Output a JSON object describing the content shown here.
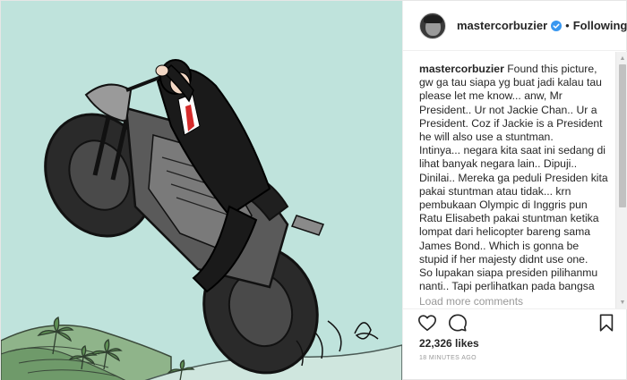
{
  "post": {
    "username": "mastercorbuzier",
    "separator": "•",
    "follow_status": "Following",
    "caption_author": "mastercorbuzier",
    "caption_text": "Found this picture, gw ga tau siapa yg buat jadi kalau tau please let me know... anw, Mr President.. Ur not Jackie Chan.. Ur a President. Coz if Jackie is a President he will also use a stuntman.\nIntinya... negara kita saat ini sedang di lihat banyak negara lain.. Dipuji.. Dinilai.. Mereka ga peduli Presiden kita pakai stuntman atau tidak... krn pembukaan Olympic di Inggris pun Ratu Elisabeth pakai stuntman ketika lompat dari helicopter bareng sama James Bond.. Which is gonna be stupid if her majesty didnt use one.\nSo lupakan siapa presiden pilihanmu nanti.. Tapi perlihatkan pada bangsa lain yang kebetulan ada di negara kita... that we are coll as it is...\nPS; I gonna need BIGGER bike if I'm the President...",
    "load_more": "Load more comments",
    "likes": "22,326 likes",
    "timestamp": "18 MINUTES AGO"
  },
  "icons": {
    "verified": "verified-badge-icon",
    "like": "heart-icon",
    "comment": "comment-bubble-icon",
    "save": "bookmark-icon"
  },
  "colors": {
    "verified": "#3897f0",
    "image_sky": "#bfe3dc",
    "muted_text": "#999999",
    "tie": "#d62b2b"
  }
}
